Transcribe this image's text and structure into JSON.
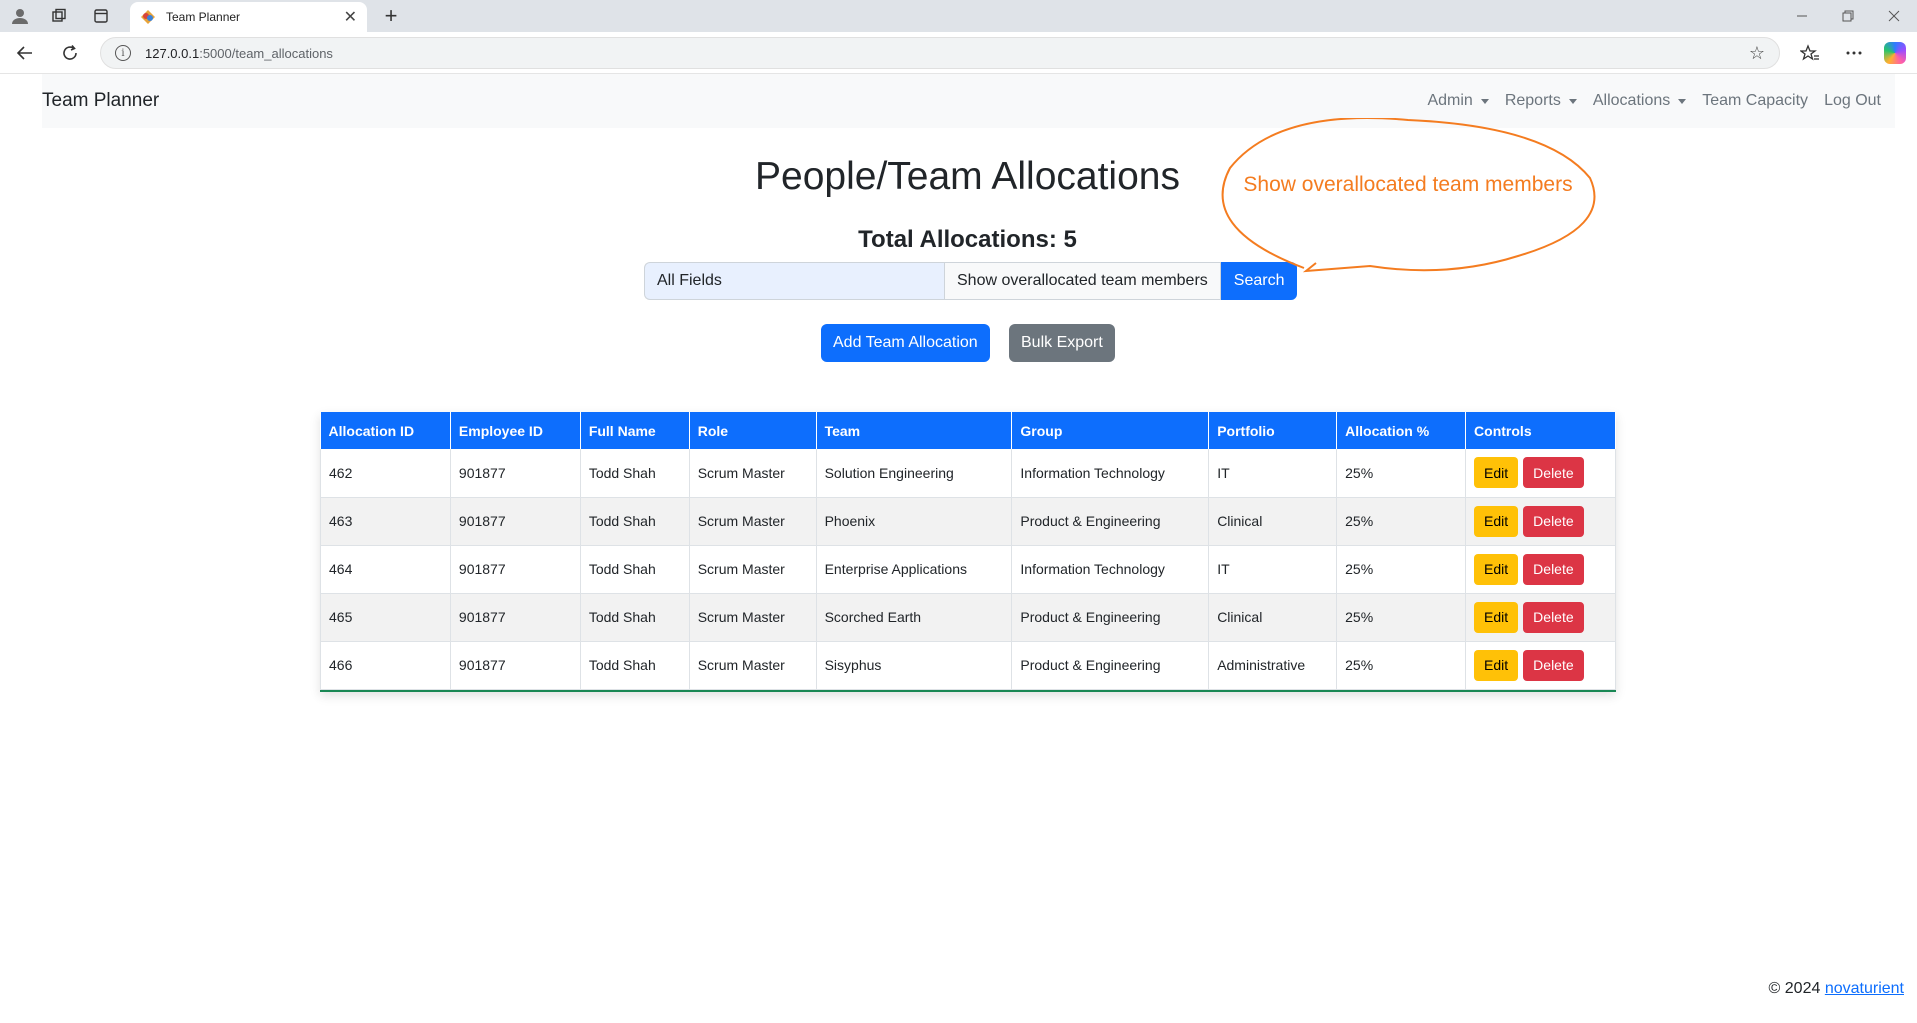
{
  "browser": {
    "tab_title": "Team Planner",
    "url_host": "127.0.0.1",
    "url_path": ":5000/team_allocations",
    "new_tab_glyph": "+",
    "close_glyph": "✕"
  },
  "navbar": {
    "brand": "Team Planner",
    "links": [
      {
        "label": "Admin",
        "dropdown": true
      },
      {
        "label": "Reports",
        "dropdown": true
      },
      {
        "label": "Allocations",
        "dropdown": true
      },
      {
        "label": "Team Capacity",
        "dropdown": false
      },
      {
        "label": "Log Out",
        "dropdown": false
      }
    ]
  },
  "page": {
    "title": "People/Team Allocations",
    "total": "Total Allocations: 5"
  },
  "search": {
    "input_value": "All Fields",
    "filter_label": "Show overallocated team members",
    "button_label": "Search"
  },
  "actions": {
    "add_label": "Add Team Allocation",
    "export_label": "Bulk Export"
  },
  "callout": {
    "text": "Show overallocated team members",
    "color": "#f47c20"
  },
  "table": {
    "headers": [
      "Allocation ID",
      "Employee ID",
      "Full Name",
      "Role",
      "Team",
      "Group",
      "Portfolio",
      "Allocation %",
      "Controls"
    ],
    "edit_label": "Edit",
    "delete_label": "Delete",
    "rows": [
      [
        "462",
        "901877",
        "Todd Shah",
        "Scrum Master",
        "Solution Engineering",
        "Information Technology",
        "IT",
        "25%"
      ],
      [
        "463",
        "901877",
        "Todd Shah",
        "Scrum Master",
        "Phoenix",
        "Product & Engineering",
        "Clinical",
        "25%"
      ],
      [
        "464",
        "901877",
        "Todd Shah",
        "Scrum Master",
        "Enterprise Applications",
        "Information Technology",
        "IT",
        "25%"
      ],
      [
        "465",
        "901877",
        "Todd Shah",
        "Scrum Master",
        "Scorched Earth",
        "Product & Engineering",
        "Clinical",
        "25%"
      ],
      [
        "466",
        "901877",
        "Todd Shah",
        "Scrum Master",
        "Sisyphus",
        "Product & Engineering",
        "Administrative",
        "25%"
      ]
    ]
  },
  "footer": {
    "copyright": "© 2024",
    "link": "novaturient"
  },
  "colors": {
    "primary": "#0d6efd",
    "secondary": "#6c757d",
    "warning": "#ffc107",
    "danger": "#dc3545",
    "success": "#198754"
  }
}
